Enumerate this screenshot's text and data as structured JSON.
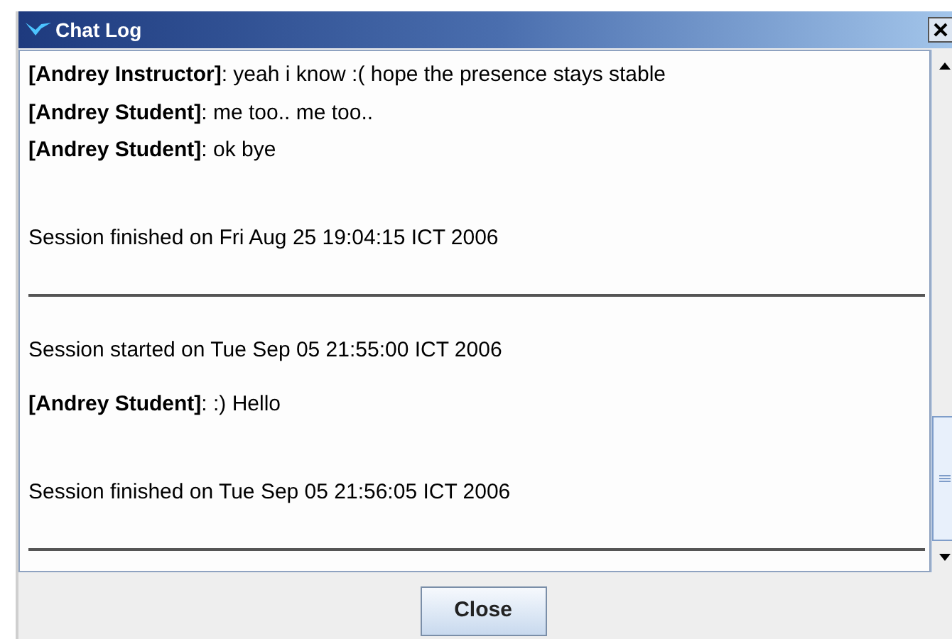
{
  "window": {
    "title": "Chat Log"
  },
  "log": [
    {
      "kind": "message",
      "text": "**[Andrey Instructor]**: yeah i know :( hope the presence stays stable"
    },
    {
      "kind": "message",
      "text": "**[Andrey Student]**: me too.. me too.."
    },
    {
      "kind": "message",
      "text": "**[Andrey Student]**: ok bye"
    },
    {
      "kind": "gap"
    },
    {
      "kind": "note",
      "text": "Session finished on Fri Aug 25 19:04:15 ICT 2006"
    },
    {
      "kind": "divider"
    },
    {
      "kind": "note",
      "text": "Session started on Tue Sep 05 21:55:00 ICT 2006"
    },
    {
      "kind": "message",
      "text": "**[Andrey Student]**: :) Hello"
    },
    {
      "kind": "gap"
    },
    {
      "kind": "note",
      "text": "Session finished on Tue Sep 05 21:56:05 ICT 2006"
    },
    {
      "kind": "divider"
    }
  ],
  "buttons": [
    {
      "label": "Close"
    }
  ]
}
